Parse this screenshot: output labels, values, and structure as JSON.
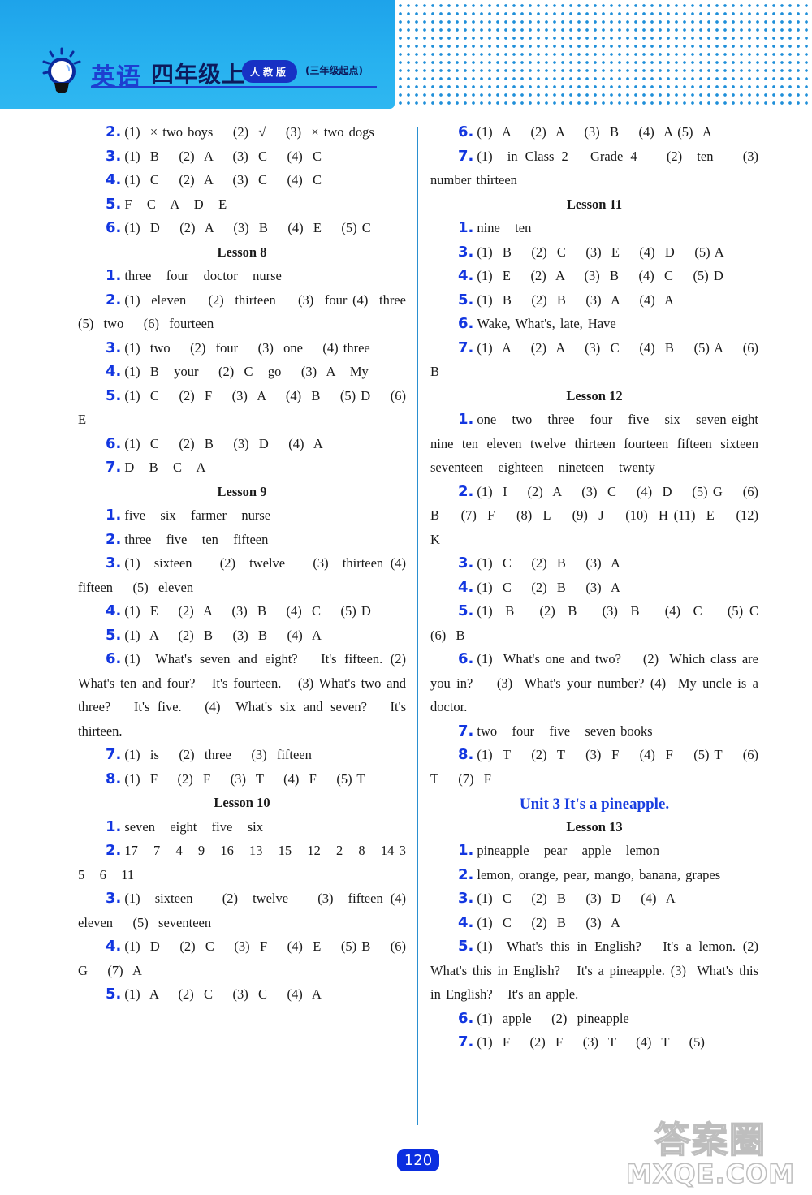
{
  "header": {
    "subject": "英语",
    "grade": "四年级上",
    "edition_badge": "人教版",
    "edition_note": "(三年级起点)",
    "icon": "lightbulb-icon"
  },
  "left_column": {
    "blocks": [
      {
        "type": "q",
        "num": "2.",
        "text": "(1)  × two boys    (2)  √    (3)  × two dogs"
      },
      {
        "type": "q",
        "num": "3.",
        "text": "(1)  B    (2)  A    (3)  C    (4)  C"
      },
      {
        "type": "q",
        "num": "4.",
        "text": "(1)  C    (2)  A    (3)  C    (4)  C"
      },
      {
        "type": "q",
        "num": "5.",
        "text": "F   C   A   D   E"
      },
      {
        "type": "q",
        "num": "6.",
        "text": "(1)  D    (2)  A    (3)  B    (4)  E    (5) C"
      },
      {
        "type": "lesson",
        "text": "Lesson 8"
      },
      {
        "type": "q",
        "num": "1.",
        "text": "three   four   doctor   nurse"
      },
      {
        "type": "q",
        "num": "2.",
        "text": "(1)  eleven    (2)  thirteen    (3)  four (4)  three    (5)  two    (6)  fourteen"
      },
      {
        "type": "q",
        "num": "3.",
        "text": "(1)  two    (2)  four    (3)  one    (4) three"
      },
      {
        "type": "q",
        "num": "4.",
        "text": "(1)  B   your    (2)  C   go    (3)  A   My"
      },
      {
        "type": "q",
        "num": "5.",
        "text": "(1)  C    (2)  F    (3)  A    (4)  B    (5) D    (6)  E"
      },
      {
        "type": "q",
        "num": "6.",
        "text": "(1)  C    (2)  B    (3)  D    (4)  A"
      },
      {
        "type": "q",
        "num": "7.",
        "text": "D   B   C   A"
      },
      {
        "type": "lesson",
        "text": "Lesson 9"
      },
      {
        "type": "q",
        "num": "1.",
        "text": "five   six   farmer   nurse"
      },
      {
        "type": "q",
        "num": "2.",
        "text": "three   five   ten   fifteen"
      },
      {
        "type": "q",
        "num": "3.",
        "text": "(1)  sixteen    (2)  twelve    (3)  thirteen (4)  fifteen    (5)  eleven"
      },
      {
        "type": "q",
        "num": "4.",
        "text": "(1)  E    (2)  A    (3)  B    (4)  C    (5) D"
      },
      {
        "type": "q",
        "num": "5.",
        "text": "(1)  A    (2)  B    (3)  B    (4)  A"
      },
      {
        "type": "q",
        "num": "6.",
        "text": "(1)  What's seven and eight?   It's fifteen. (2)  What's ten and four?   It's fourteen.   (3) What's two and three?   It's five.   (4)  What's six and seven?   It's thirteen."
      },
      {
        "type": "q",
        "num": "7.",
        "text": "(1)  is    (2)  three    (3)  fifteen"
      },
      {
        "type": "q",
        "num": "8.",
        "text": "(1)  F    (2)  F    (3)  T    (4)  F    (5) T"
      },
      {
        "type": "lesson",
        "text": "Lesson 10"
      },
      {
        "type": "q",
        "num": "1.",
        "text": "seven   eight   five   six"
      },
      {
        "type": "q",
        "num": "2.",
        "text": "17   7   4   9   16   13   15   12   2   8   14 3   5   6   11"
      },
      {
        "type": "q",
        "num": "3.",
        "text": "(1)  sixteen    (2)  twelve    (3)  fifteen (4)  eleven    (5)  seventeen"
      },
      {
        "type": "q",
        "num": "4.",
        "text": "(1)  D    (2)  C    (3)  F    (4)  E    (5) B    (6)  G    (7)  A"
      },
      {
        "type": "q",
        "num": "5.",
        "text": "(1)  A    (2)  C    (3)  C    (4)  A"
      }
    ]
  },
  "right_column": {
    "blocks": [
      {
        "type": "q",
        "num": "6.",
        "text": "(1)  A    (2)  A    (3)  B    (4)  A (5)  A"
      },
      {
        "type": "q",
        "num": "7.",
        "text": "(1)  in Class 2   Grade 4    (2)  ten    (3) number thirteen"
      },
      {
        "type": "lesson",
        "text": "Lesson 11"
      },
      {
        "type": "q",
        "num": "1.",
        "text": "nine   ten"
      },
      {
        "type": "q",
        "num": "3.",
        "text": "(1)  B    (2)  C    (3)  E    (4)  D    (5) A"
      },
      {
        "type": "q",
        "num": "4.",
        "text": "(1)  E    (2)  A    (3)  B    (4)  C    (5) D"
      },
      {
        "type": "q",
        "num": "5.",
        "text": "(1)  B    (2)  B    (3)  A    (4)  A"
      },
      {
        "type": "q",
        "num": "6.",
        "text": "Wake, What's, late, Have"
      },
      {
        "type": "q",
        "num": "7.",
        "text": "(1)  A    (2)  A    (3)  C    (4)  B    (5) A    (6)  B"
      },
      {
        "type": "lesson",
        "text": "Lesson 12"
      },
      {
        "type": "q",
        "num": "1.",
        "text": "one   two   three   four   five   six   seven eight nine ten eleven twelve thirteen fourteen fifteen sixteen seventeen   eighteen   nineteen   twenty"
      },
      {
        "type": "q",
        "num": "2.",
        "text": "(1)  I    (2)  A    (3)  C    (4)  D    (5) G    (6)  B    (7)  F    (8)  L    (9)  J    (10)  H (11)  E    (12)  K"
      },
      {
        "type": "q",
        "num": "3.",
        "text": "(1)  C    (2)  B    (3)  A"
      },
      {
        "type": "q",
        "num": "4.",
        "text": "(1)  C    (2)  B    (3)  A"
      },
      {
        "type": "q",
        "num": "5.",
        "text": "(1)  B    (2)  B    (3)  B    (4)  C    (5) C    (6)  B"
      },
      {
        "type": "q",
        "num": "6.",
        "text": "(1)  What's one and two?    (2)  Which class are you in?    (3)  What's your number? (4)  My uncle is a doctor."
      },
      {
        "type": "q",
        "num": "7.",
        "text": "two   four   five   seven books"
      },
      {
        "type": "q",
        "num": "8.",
        "text": "(1)  T    (2)  T    (3)  F    (4)  F    (5) T    (6)  T    (7)  F"
      },
      {
        "type": "unit",
        "text": "Unit 3   It's a pineapple."
      },
      {
        "type": "lesson",
        "text": "Lesson 13"
      },
      {
        "type": "q",
        "num": "1.",
        "text": "pineapple   pear   apple   lemon"
      },
      {
        "type": "q",
        "num": "2.",
        "text": "lemon, orange, pear, mango, banana, grapes"
      },
      {
        "type": "q",
        "num": "3.",
        "text": "(1)  C    (2)  B    (3)  D    (4)  A"
      },
      {
        "type": "q",
        "num": "4.",
        "text": "(1)  C    (2)  B    (3)  A"
      },
      {
        "type": "q",
        "num": "5.",
        "text": "(1)  What's this in English?   It's a lemon. (2)  What's this in English?   It's a pineapple. (3)  What's this in English?   It's an apple."
      },
      {
        "type": "q",
        "num": "6.",
        "text": "(1)  apple    (2)  pineapple"
      },
      {
        "type": "q",
        "num": "7.",
        "text": "(1)  F    (2)  F    (3)  T    (4)  T    (5)"
      }
    ]
  },
  "footer": {
    "page_number": "120",
    "watermark_cn": "答案圈",
    "watermark_en": "MXQE.COM"
  },
  "colors": {
    "header_blue": "#27b1ef",
    "accent_blue": "#1236e0",
    "badge_blue": "#1731c4",
    "page_number_bg": "#0b2ee0",
    "divider": "#2a8fd0"
  }
}
